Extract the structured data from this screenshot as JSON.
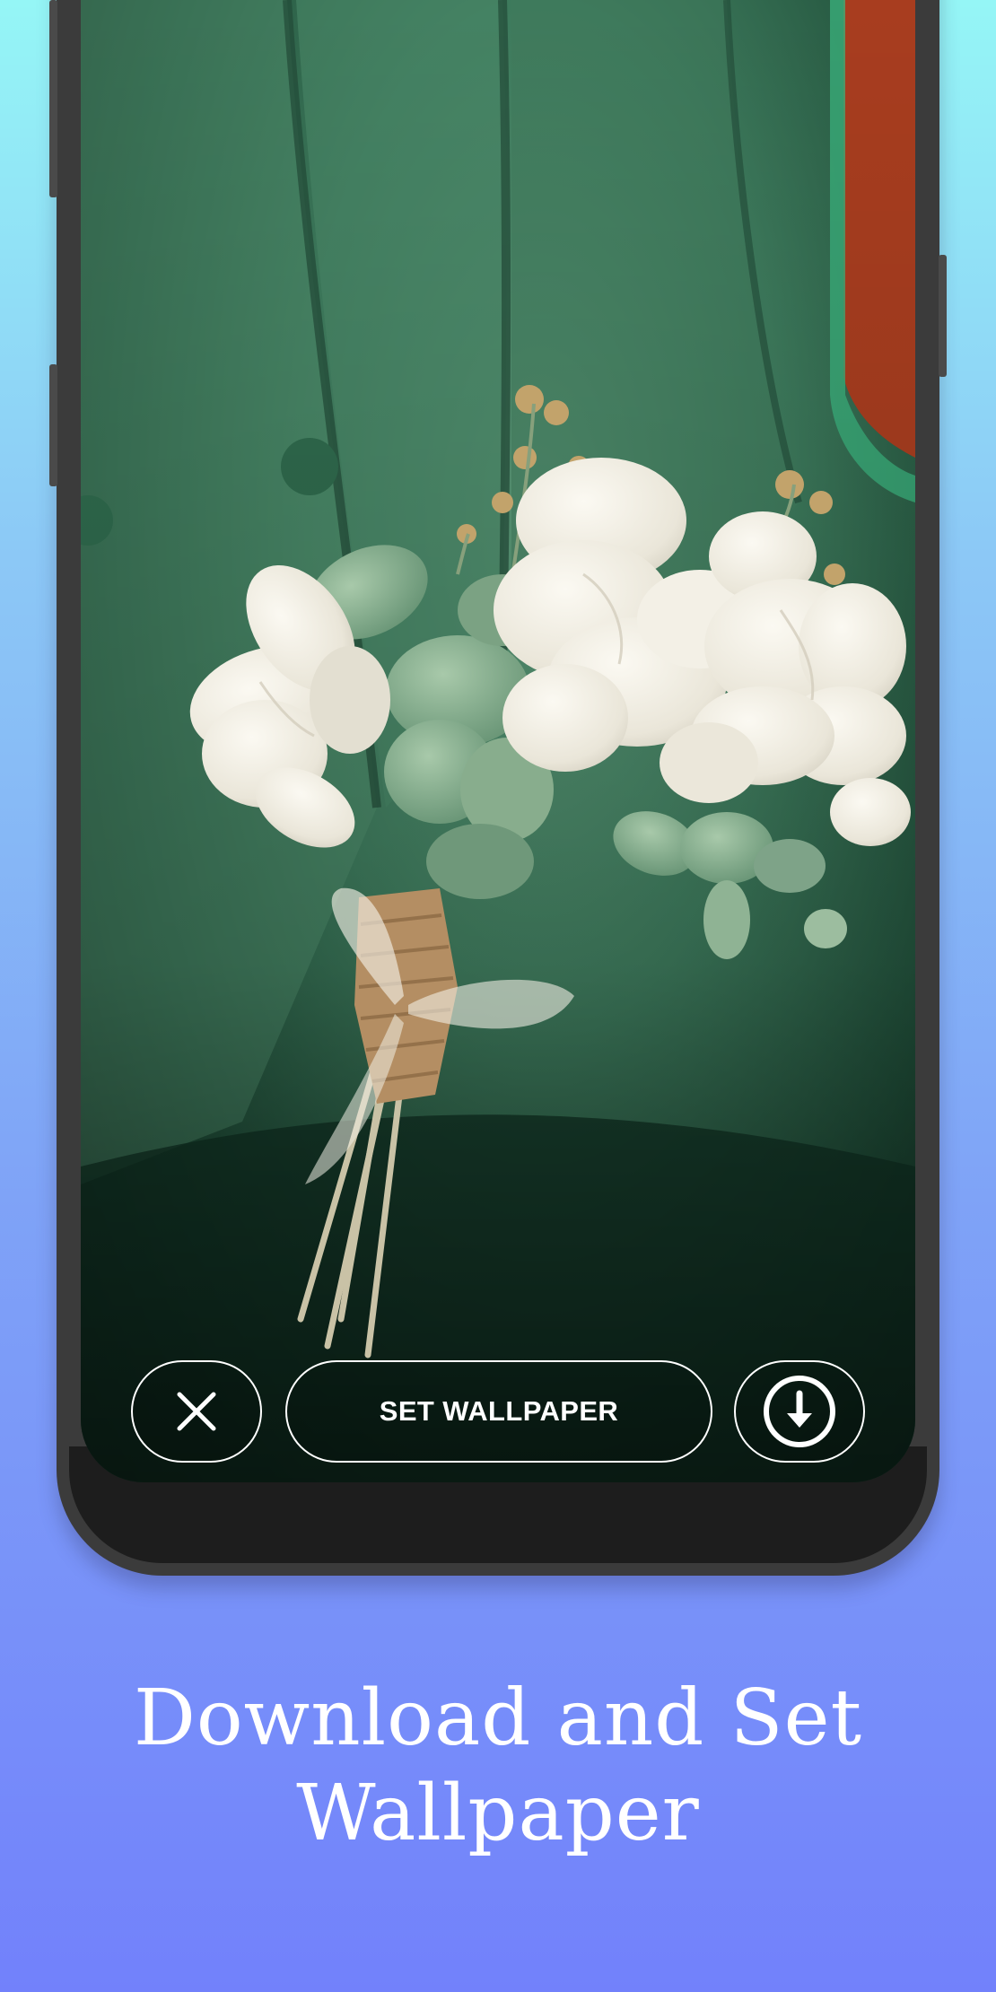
{
  "actions": {
    "close_icon": "close-icon",
    "set_wallpaper_label": "SET WALLPAPER",
    "download_icon": "download-icon"
  },
  "caption": {
    "line1": "Download and Set",
    "line2": "Wallpaper"
  },
  "colors": {
    "background_top": "#95f6f6",
    "background_bottom": "#7281fb",
    "phone_frame": "#3b3b3b",
    "button_outline": "#ffffff"
  }
}
